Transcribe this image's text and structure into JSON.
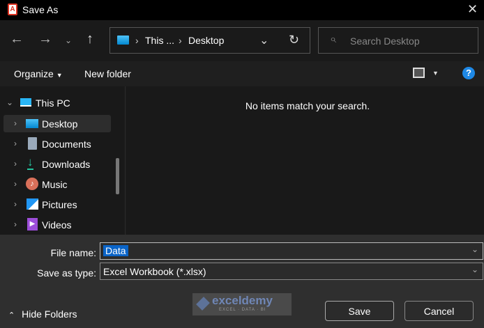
{
  "window": {
    "title": "Save As"
  },
  "address": {
    "segments": [
      "This ...",
      "Desktop"
    ]
  },
  "search": {
    "placeholder": "Search Desktop"
  },
  "toolbar": {
    "organize": "Organize",
    "new_folder": "New folder",
    "help": "?"
  },
  "sidebar": {
    "root": "This PC",
    "items": [
      {
        "label": "Desktop",
        "selected": true
      },
      {
        "label": "Documents"
      },
      {
        "label": "Downloads"
      },
      {
        "label": "Music"
      },
      {
        "label": "Pictures"
      },
      {
        "label": "Videos"
      }
    ]
  },
  "content": {
    "empty_message": "No items match your search."
  },
  "form": {
    "file_name_label": "File name:",
    "file_name_value": "Data",
    "type_label": "Save as type:",
    "type_value": "Excel Workbook (*.xlsx)"
  },
  "footer": {
    "hide_folders": "Hide Folders",
    "save": "Save",
    "cancel": "Cancel"
  },
  "watermark": {
    "name": "exceldemy",
    "tagline": "EXCEL · DATA · BI"
  }
}
